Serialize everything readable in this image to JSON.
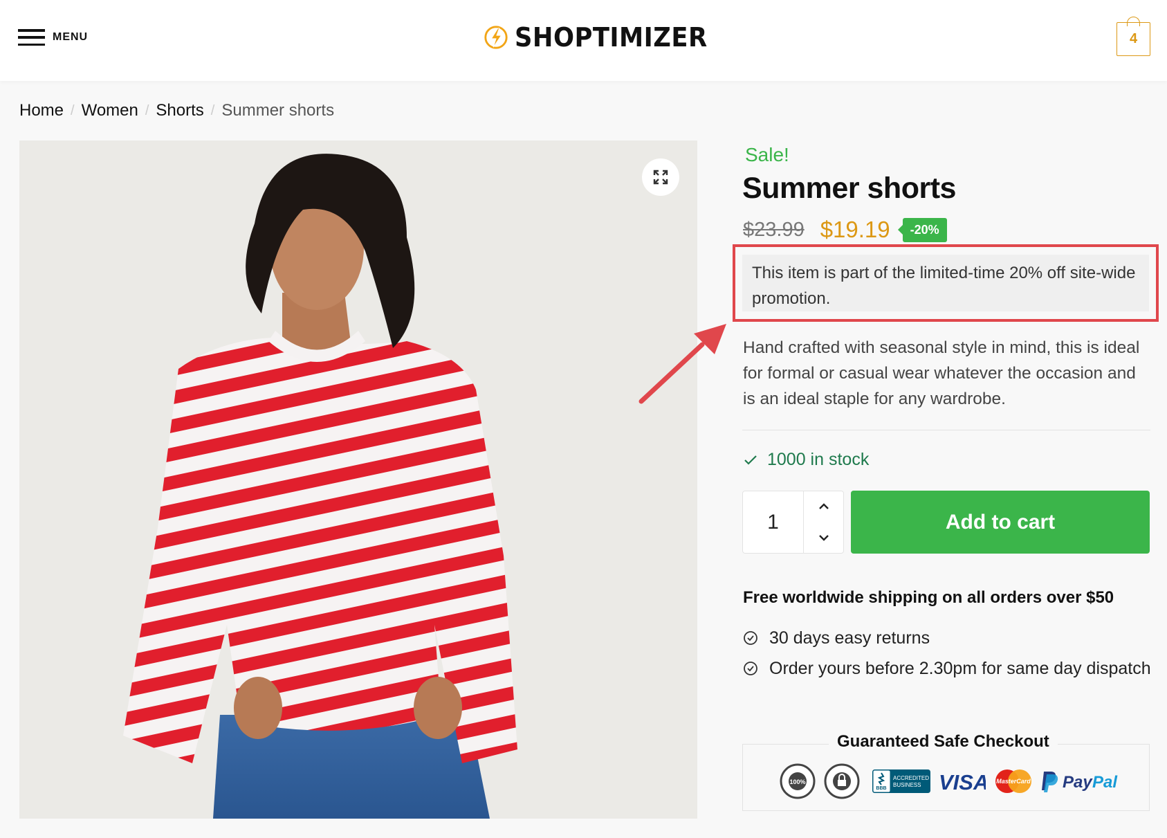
{
  "header": {
    "menu_label": "MENU",
    "logo_text": "SHOPTIMIZER",
    "cart_count": "4",
    "accent_color": "#dc9814"
  },
  "breadcrumb": {
    "items": [
      "Home",
      "Women",
      "Shorts"
    ],
    "current": "Summer shorts",
    "separator": "/"
  },
  "product": {
    "sale_label": "Sale!",
    "title": "Summer shorts",
    "old_price": "$23.99",
    "new_price": "$19.19",
    "discount_badge": "-20%",
    "promo_text": "This item is part of the limited-time 20% off site-wide promotion.",
    "description": "Hand crafted with seasonal style in mind, this is ideal for formal or casual wear whatever the occasion and is an ideal staple for any wardrobe.",
    "stock": "1000 in stock",
    "quantity": "1",
    "add_to_cart_label": "Add to cart",
    "sale_color": "#3bb54a"
  },
  "shipping": {
    "title": "Free worldwide shipping on all orders over $50",
    "perks": [
      "30 days easy returns",
      "Order yours before 2.30pm for same day dispatch"
    ]
  },
  "checkout": {
    "title": "Guaranteed Safe Checkout",
    "badges": [
      "satisfaction-guaranteed",
      "secure-ordering",
      "bbb-accredited-business",
      "visa",
      "mastercard",
      "paypal"
    ],
    "satisfaction_text": "100%",
    "bbb_text_1": "ACCREDITED",
    "bbb_text_2": "BUSINESS",
    "visa_text": "VISA",
    "mastercard_text": "MasterCard",
    "paypal_text_1": "Pay",
    "paypal_text_2": "Pal"
  },
  "annotation": {
    "highlight_color": "#e0474c"
  }
}
